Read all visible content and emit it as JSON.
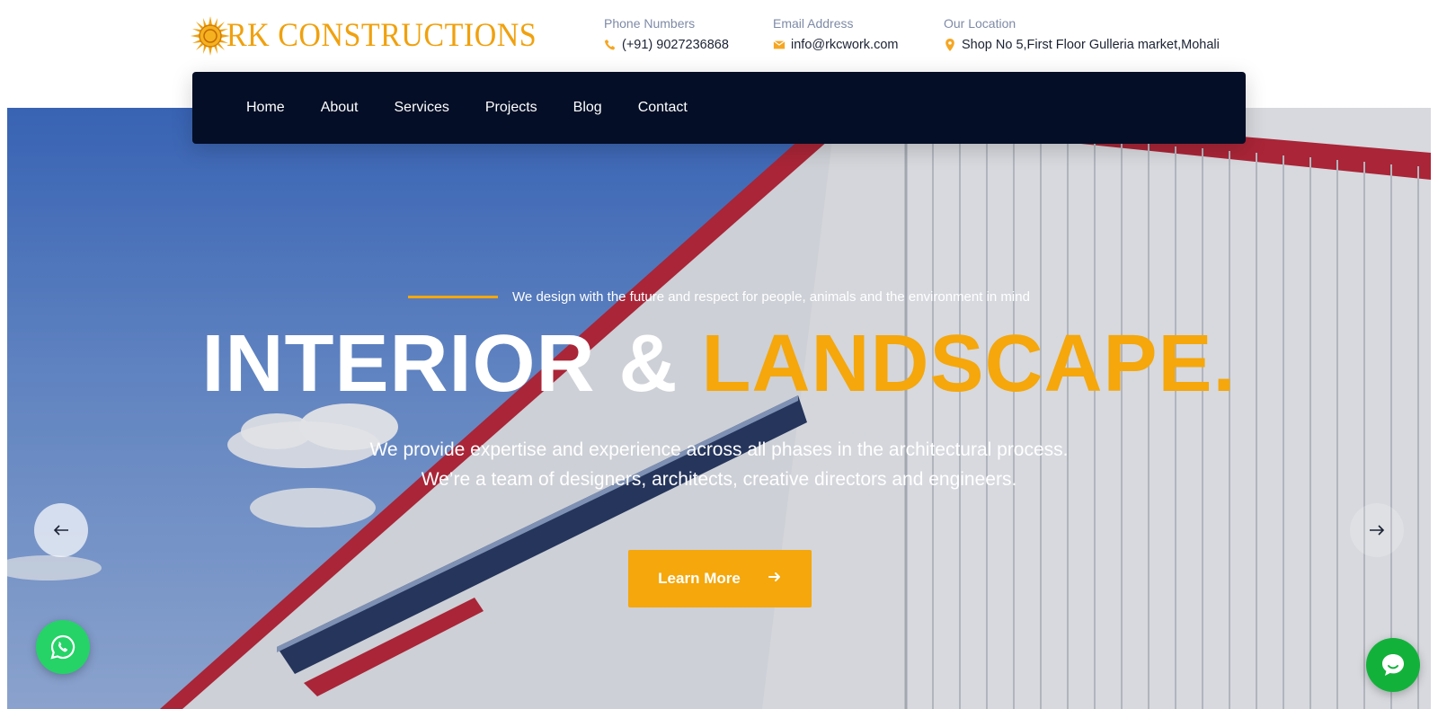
{
  "brand": {
    "name": "RK CONSTRUCTIONS",
    "accent": "#f5a70b",
    "nav_bg": "#040e26"
  },
  "contacts": [
    {
      "label": "Phone Numbers",
      "value": "(+91) 9027236868",
      "icon": "phone-icon"
    },
    {
      "label": "Email Address",
      "value": "info@rkcwork.com",
      "icon": "envelope-icon"
    },
    {
      "label": "Our Location",
      "value": "Shop No 5,First Floor Gulleria market,Mohali",
      "icon": "map-pin-icon"
    }
  ],
  "nav": {
    "items": [
      "Home",
      "About",
      "Services",
      "Projects",
      "Blog",
      "Contact"
    ]
  },
  "hero": {
    "tagline": "We design with the future and respect for people, animals and the environment in mind",
    "headline_white": "INTERIOR & ",
    "headline_accent": "LANDSCAPE.",
    "description_line1": "We provide expertise and experience across all phases in the architectural process.",
    "description_line2": "We’re a team of designers, architects, creative directors and engineers.",
    "cta_label": "Learn More",
    "cta_icon": "arrow-right-icon",
    "prev_icon": "arrow-left-icon",
    "next_icon": "arrow-right-icon"
  },
  "widgets": {
    "whatsapp_icon": "whatsapp-icon",
    "chat_icon": "chat-bubble-icon"
  }
}
